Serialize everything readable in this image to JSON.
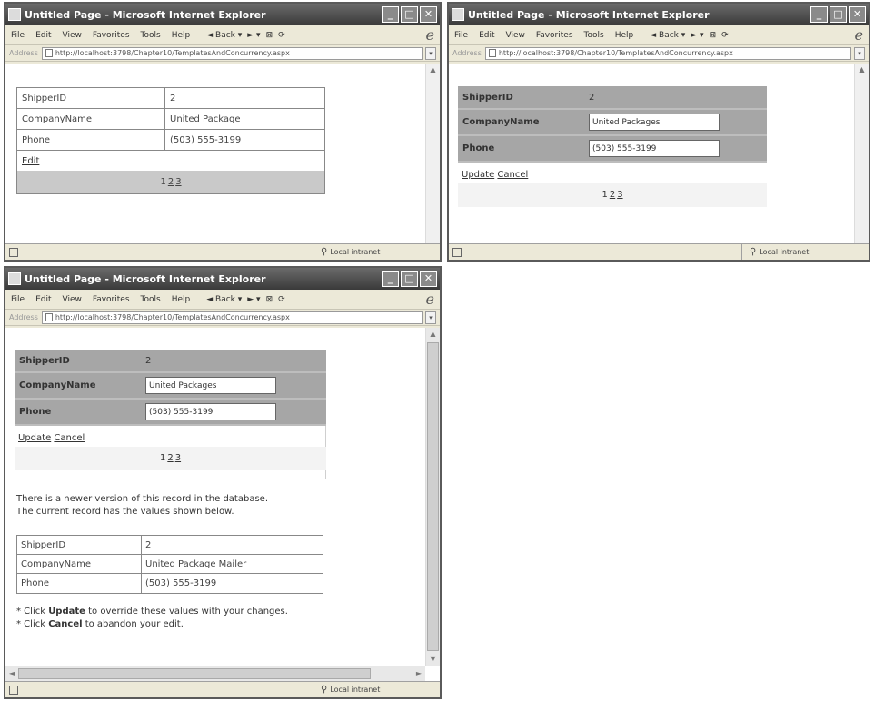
{
  "window": {
    "title": "Untitled Page - Microsoft Internet Explorer",
    "menu": [
      "File",
      "Edit",
      "View",
      "Favorites",
      "Tools",
      "Help"
    ],
    "back_label": "Back",
    "address_label": "Address",
    "url": "http://localhost:3798/Chapter10/TemplatesAndConcurrency.aspx",
    "status_zone": "Local intranet"
  },
  "screen1": {
    "fields": [
      {
        "name": "ShipperID",
        "value": "2"
      },
      {
        "name": "CompanyName",
        "value": "United Package"
      },
      {
        "name": "Phone",
        "value": "(503) 555-3199"
      }
    ],
    "edit_link": "Edit",
    "pager": [
      "1",
      "2",
      "3"
    ]
  },
  "screen2": {
    "shipper_label": "ShipperID",
    "shipper_value": "2",
    "company_label": "CompanyName",
    "company_value": "United Packages",
    "phone_label": "Phone",
    "phone_value": "(503) 555-3199",
    "update_link": "Update",
    "cancel_link": "Cancel",
    "pager": [
      "1",
      "2",
      "3"
    ]
  },
  "screen3": {
    "shipper_label": "ShipperID",
    "shipper_value": "2",
    "company_label": "CompanyName",
    "company_value": "United Packages",
    "phone_label": "Phone",
    "phone_value": "(503) 555-3199",
    "update_link": "Update",
    "cancel_link": "Cancel",
    "pager": [
      "1",
      "2",
      "3"
    ],
    "message_line1": "There is a newer version of this record in the database.",
    "message_line2": "The current record has the values shown below.",
    "db_fields": [
      {
        "name": "ShipperID",
        "value": "2"
      },
      {
        "name": "CompanyName",
        "value": "United Package Mailer"
      },
      {
        "name": "Phone",
        "value": "(503) 555-3199"
      }
    ],
    "instr1_pre": "* Click ",
    "instr1_bold": "Update",
    "instr1_post": " to override these values with your changes.",
    "instr2_pre": "* Click ",
    "instr2_bold": "Cancel",
    "instr2_post": " to abandon your edit."
  }
}
